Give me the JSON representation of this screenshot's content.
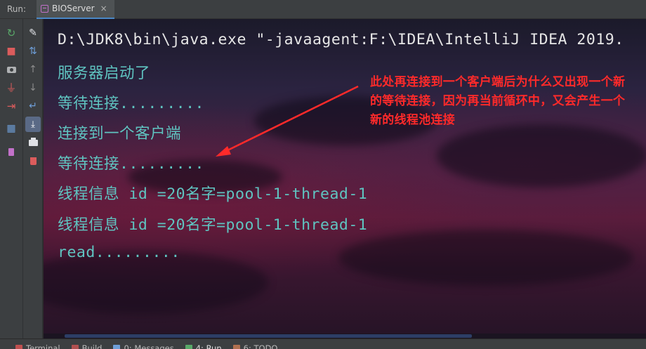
{
  "header": {
    "run_label": "Run:",
    "tab": {
      "label": "BIOServer",
      "close_glyph": "×",
      "icon": "java-class-icon"
    }
  },
  "toolbar_left": {
    "items": [
      {
        "name": "rerun-icon",
        "glyph": "↻",
        "color": "#59a869"
      },
      {
        "name": "stop-icon",
        "glyph": "■",
        "color": "#db5c5c"
      },
      {
        "name": "camera-icon",
        "glyph": "📷",
        "color": "#afb1b3"
      },
      {
        "name": "plug-icon",
        "glyph": "⏚",
        "color": "#db5c5c"
      },
      {
        "name": "exit-icon",
        "glyph": "⇥",
        "color": "#db5c5c"
      },
      {
        "name": "layout-icon",
        "glyph": "▦",
        "color": "#6e9ed8"
      },
      {
        "name": "pin-icon",
        "glyph": "📌",
        "color": "#c271c9"
      }
    ]
  },
  "toolbar_right": {
    "items": [
      {
        "name": "edit-icon",
        "glyph": "✎",
        "color": "#dfe1e5"
      },
      {
        "name": "sort-icon",
        "glyph": "⇅",
        "color": "#6e9ed8"
      },
      {
        "name": "up-arrow-icon",
        "glyph": "↑",
        "color": "#8c8c8c"
      },
      {
        "name": "down-arrow-icon",
        "glyph": "↓",
        "color": "#8c8c8c"
      },
      {
        "name": "soft-wrap-icon",
        "glyph": "↵",
        "color": "#6e9ed8"
      },
      {
        "name": "scroll-to-end-icon",
        "glyph": "⤓",
        "color": "#dfe1e5"
      },
      {
        "name": "print-icon",
        "glyph": "⎙",
        "color": "#dfe1e5"
      },
      {
        "name": "trash-icon",
        "glyph": "🗑",
        "color": "#db5c5c"
      }
    ]
  },
  "console": {
    "lines": [
      {
        "text": "D:\\JDK8\\bin\\java.exe \"-javaagent:F:\\IDEA\\IntelliJ IDEA 2019.",
        "kind": "cmd"
      },
      {
        "text": "服务器启动了",
        "kind": "out"
      },
      {
        "text": "等待连接.........",
        "kind": "out"
      },
      {
        "text": "连接到一个客户端",
        "kind": "out"
      },
      {
        "text": "等待连接.........",
        "kind": "out"
      },
      {
        "text": "线程信息 id =20名字=pool-1-thread-1",
        "kind": "out"
      },
      {
        "text": "线程信息 id =20名字=pool-1-thread-1",
        "kind": "out"
      },
      {
        "text": "read.........",
        "kind": "out"
      }
    ],
    "annotation": "此处再连接到一个客户端后为什么又出现一个新的等待连接，因为再当前循环中，又会产生一个新的线程池连接",
    "annotation_color": "#ff2a2a",
    "text_color": "#5fc4c1"
  },
  "bottombar": {
    "items": [
      {
        "label": "Terminal",
        "icon": "terminal-icon",
        "color": "#c05050"
      },
      {
        "label": "Build",
        "icon": "build-icon",
        "color": "#b05050"
      },
      {
        "label": "0: Messages",
        "icon": "messages-icon",
        "color": "#6e9ed8"
      },
      {
        "label": "4: Run",
        "icon": "run-icon",
        "color": "#59a869"
      },
      {
        "label": "6: TODO",
        "icon": "todo-icon",
        "color": "#b07050"
      }
    ]
  }
}
